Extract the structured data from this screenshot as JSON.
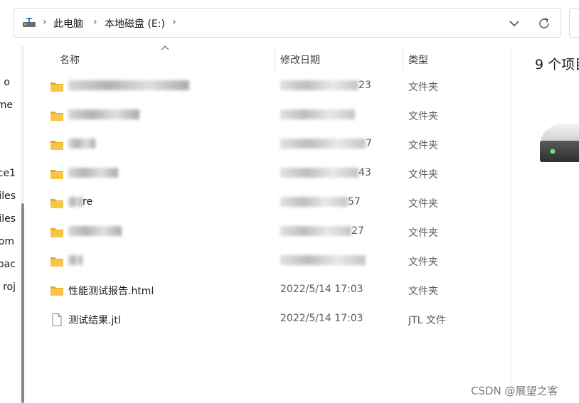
{
  "breadcrumb": {
    "items": [
      "此电脑",
      "本地磁盘 (E:)"
    ]
  },
  "nav": {
    "items": [
      "o",
      "me",
      "ce1",
      "iles",
      "iles",
      "om",
      "oac",
      "roj"
    ]
  },
  "columns": {
    "name": "名称",
    "date": "修改日期",
    "type": "类型"
  },
  "rows": [
    {
      "name": "",
      "date": "23",
      "type": "文件夹",
      "icon": "folder-icon",
      "blurred": true
    },
    {
      "name": "",
      "date": "",
      "type": "文件夹",
      "icon": "folder-icon",
      "blurred": true
    },
    {
      "name": "",
      "date": "7",
      "type": "文件夹",
      "icon": "folder-icon",
      "blurred": true
    },
    {
      "name": "",
      "date": "43",
      "type": "文件夹",
      "icon": "folder-icon",
      "blurred": true
    },
    {
      "name": "re",
      "date": "57",
      "type": "文件夹",
      "icon": "folder-icon",
      "blurred": true
    },
    {
      "name": "",
      "date": "27",
      "type": "文件夹",
      "icon": "folder-icon",
      "blurred": true
    },
    {
      "name": "",
      "date": "",
      "type": "文件夹",
      "icon": "folder-icon",
      "blurred": true
    },
    {
      "name": "性能测试报告.html",
      "date": "2022/5/14 17:03",
      "type": "文件夹",
      "icon": "folder-icon",
      "blurred": false
    },
    {
      "name": "测试结果.jtl",
      "date": "2022/5/14 17:03",
      "type": "JTL 文件",
      "icon": "file-icon",
      "blurred": false
    }
  ],
  "details": {
    "item_count": "9 个项目"
  },
  "watermark": "CSDN @展望之客",
  "colors": {
    "folder": "#f8c645",
    "folder_dark": "#e7a82a",
    "accent": "#0067c0"
  }
}
